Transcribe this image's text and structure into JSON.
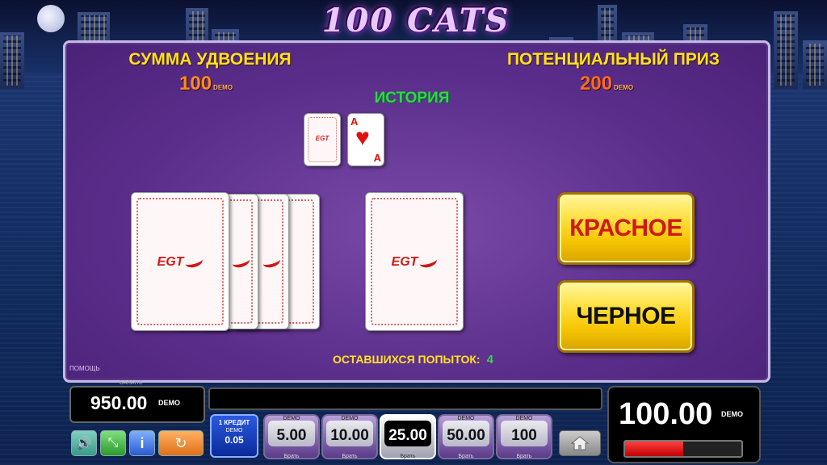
{
  "game": {
    "logo": "100 CATS"
  },
  "gamble": {
    "left_title": "СУММА УДВОЕНИЯ",
    "left_amount": "100",
    "right_title": "ПОТЕНЦИАЛЬНЫЙ ПРИЗ",
    "right_amount": "200",
    "demo": "DEMO",
    "history_label": "ИСТОРИЯ",
    "history_card_back": "EGT",
    "history_card_rank": "A",
    "card_back_brand": "EGT",
    "red_button": "КРАСНОЕ",
    "black_button": "ЧЕРНОЕ",
    "tries_label": "ОСТАВШИХСЯ ПОПЫТОК:",
    "tries_value": "4",
    "help": "ПОМОЩЬ"
  },
  "footer": {
    "balance_label": "БАЛАНС",
    "balance_value": "950.00",
    "demo": "DEMO",
    "credit_line1": "1 КРЕДИТ",
    "credit_line2": "DEMO",
    "credit_value": "0.05",
    "bets": [
      {
        "demo": "DEMO",
        "value": "5.00",
        "take": "Брать"
      },
      {
        "demo": "DEMO",
        "value": "10.00",
        "take": "Брать"
      },
      {
        "demo": "DEMO",
        "value": "25.00",
        "take": "Брать"
      },
      {
        "demo": "DEMO",
        "value": "50.00",
        "take": "Брать"
      },
      {
        "demo": "DEMO",
        "value": "100",
        "take": "Брать"
      }
    ],
    "active_bet_index": 2,
    "win_value": "100.00",
    "win_progress": 0.5
  },
  "icons": [
    "sound-icon",
    "fullscreen-icon",
    "info-icon",
    "autoplay-icon",
    "home-icon"
  ]
}
